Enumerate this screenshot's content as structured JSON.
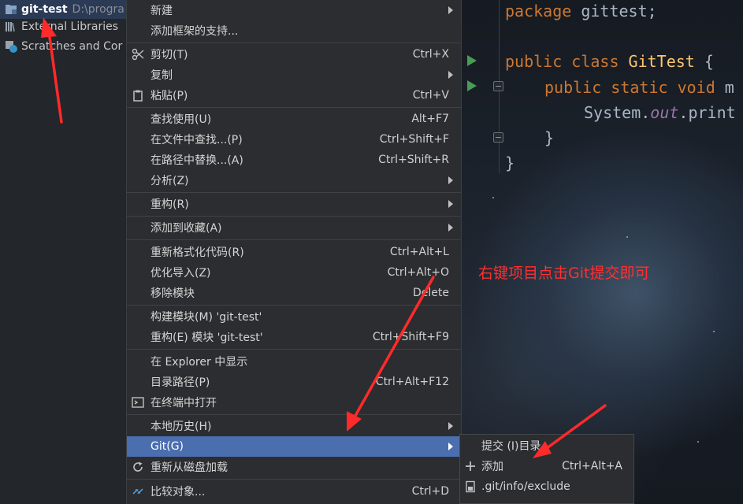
{
  "project_tree": {
    "root_name": "git-test",
    "root_path": "D:\\progra",
    "items": [
      {
        "label": "External Libraries",
        "icon": "libraries-icon"
      },
      {
        "label": "Scratches and Cor",
        "icon": "scratches-icon"
      }
    ]
  },
  "editor": {
    "lines": {
      "l1": {
        "kw": "package",
        "rest": " gittest;"
      },
      "l2": {
        "kw": "public class",
        "cls": "GitTest",
        "rest": " {"
      },
      "l3": {
        "kw": "public static void",
        "rest": " m"
      },
      "l4": {
        "a": "System.",
        "fld": "out",
        "b": ".print"
      },
      "l5": "}",
      "l6": "}"
    },
    "annotation": "右键项目点击Git提交即可"
  },
  "context_menu": {
    "items": [
      {
        "label": "新建",
        "shortcut": "",
        "submenu": true,
        "icon": ""
      },
      {
        "label": "添加框架的支持...",
        "shortcut": "",
        "submenu": false,
        "icon": ""
      },
      {
        "label": "剪切(T)",
        "shortcut": "Ctrl+X",
        "submenu": false,
        "icon": "scissors-icon"
      },
      {
        "label": "复制",
        "shortcut": "",
        "submenu": true,
        "icon": ""
      },
      {
        "label": "粘贴(P)",
        "shortcut": "Ctrl+V",
        "submenu": false,
        "icon": "clipboard-icon"
      },
      {
        "label": "查找使用(U)",
        "shortcut": "Alt+F7",
        "submenu": false,
        "icon": ""
      },
      {
        "label": "在文件中查找...(P)",
        "shortcut": "Ctrl+Shift+F",
        "submenu": false,
        "icon": ""
      },
      {
        "label": "在路径中替换...(A)",
        "shortcut": "Ctrl+Shift+R",
        "submenu": false,
        "icon": ""
      },
      {
        "label": "分析(Z)",
        "shortcut": "",
        "submenu": true,
        "icon": ""
      },
      {
        "label": "重构(R)",
        "shortcut": "",
        "submenu": true,
        "icon": ""
      },
      {
        "label": "添加到收藏(A)",
        "shortcut": "",
        "submenu": true,
        "icon": ""
      },
      {
        "label": "重新格式化代码(R)",
        "shortcut": "Ctrl+Alt+L",
        "submenu": false,
        "icon": ""
      },
      {
        "label": "优化导入(Z)",
        "shortcut": "Ctrl+Alt+O",
        "submenu": false,
        "icon": ""
      },
      {
        "label": "移除模块",
        "shortcut": "Delete",
        "submenu": false,
        "icon": ""
      },
      {
        "label": "构建模块(M) 'git-test'",
        "shortcut": "",
        "submenu": false,
        "icon": ""
      },
      {
        "label": "重构(E) 模块 'git-test'",
        "shortcut": "Ctrl+Shift+F9",
        "submenu": false,
        "icon": ""
      },
      {
        "label": "在 Explorer 中显示",
        "shortcut": "",
        "submenu": false,
        "icon": ""
      },
      {
        "label": "目录路径(P)",
        "shortcut": "Ctrl+Alt+F12",
        "submenu": false,
        "icon": ""
      },
      {
        "label": "在终端中打开",
        "shortcut": "",
        "submenu": false,
        "icon": "terminal-icon"
      },
      {
        "label": "本地历史(H)",
        "shortcut": "",
        "submenu": true,
        "icon": ""
      },
      {
        "label": "Git(G)",
        "shortcut": "",
        "submenu": true,
        "icon": ""
      },
      {
        "label": "重新从磁盘加载",
        "shortcut": "",
        "submenu": false,
        "icon": "reload-icon"
      },
      {
        "label": "比较对象...",
        "shortcut": "Ctrl+D",
        "submenu": false,
        "icon": "compare-icon"
      }
    ]
  },
  "git_submenu": {
    "items": [
      {
        "label": "提交 (I)目录",
        "shortcut": "",
        "icon": ""
      },
      {
        "label": "添加",
        "shortcut": "Ctrl+Alt+A",
        "icon": "plus-icon"
      },
      {
        "label": ".git/info/exclude",
        "shortcut": "",
        "icon": "file-icon"
      }
    ]
  },
  "colors": {
    "menu_bg": "#2b2d30",
    "highlight": "#4b6eaf",
    "annotation": "#ff3030",
    "keyword": "#cc7832",
    "class_name": "#ffc66d"
  }
}
